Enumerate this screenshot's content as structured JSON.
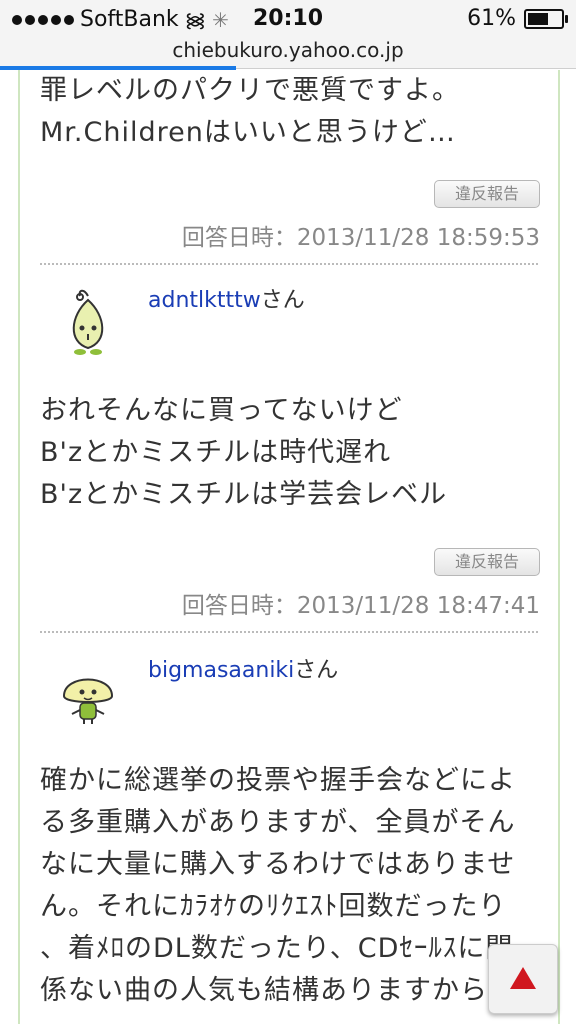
{
  "status_bar": {
    "carrier": "SoftBank",
    "time": "20:10",
    "battery": "61%",
    "battery_fraction": 0.61
  },
  "url": "chiebukuro.yahoo.co.jp",
  "page_load_progress": 0.41,
  "answers": [
    {
      "lines": [
        "罪レベルのパクリで悪質ですよ。",
        "Mr.Childrenはいいと思うけど…"
      ],
      "report_label": "違反報告",
      "date": "回答日時：2013/11/28 18:59:53"
    },
    {
      "username": "adntlktttw",
      "suffix": "さん",
      "lines": [
        "おれそんなに買ってないけど",
        "B'zとかミスチルは時代遅れ",
        "B'zとかミスチルは学芸会レベル"
      ],
      "report_label": "違反報告",
      "date": "回答日時：2013/11/28 18:47:41"
    },
    {
      "username": "bigmasaaniki",
      "suffix": "さん",
      "lines": [
        "確かに総選挙の投票や握手会などによ",
        "る多重購入がありますが、全員がそん",
        "なに大量に購入するわけではありませ",
        "ん。それにｶﾗｵｹのﾘｸｴｽﾄ回数だったり",
        "、着ﾒﾛのDL数だったり、CDｾｰﾙｽに関",
        "係ない曲の人気も結構ありますから"
      ]
    }
  ],
  "colors": {
    "link": "#1a3db5",
    "progress": "#1a7ae6",
    "frame_border": "#cfe6c0",
    "scroll_arrow": "#d0171f"
  }
}
